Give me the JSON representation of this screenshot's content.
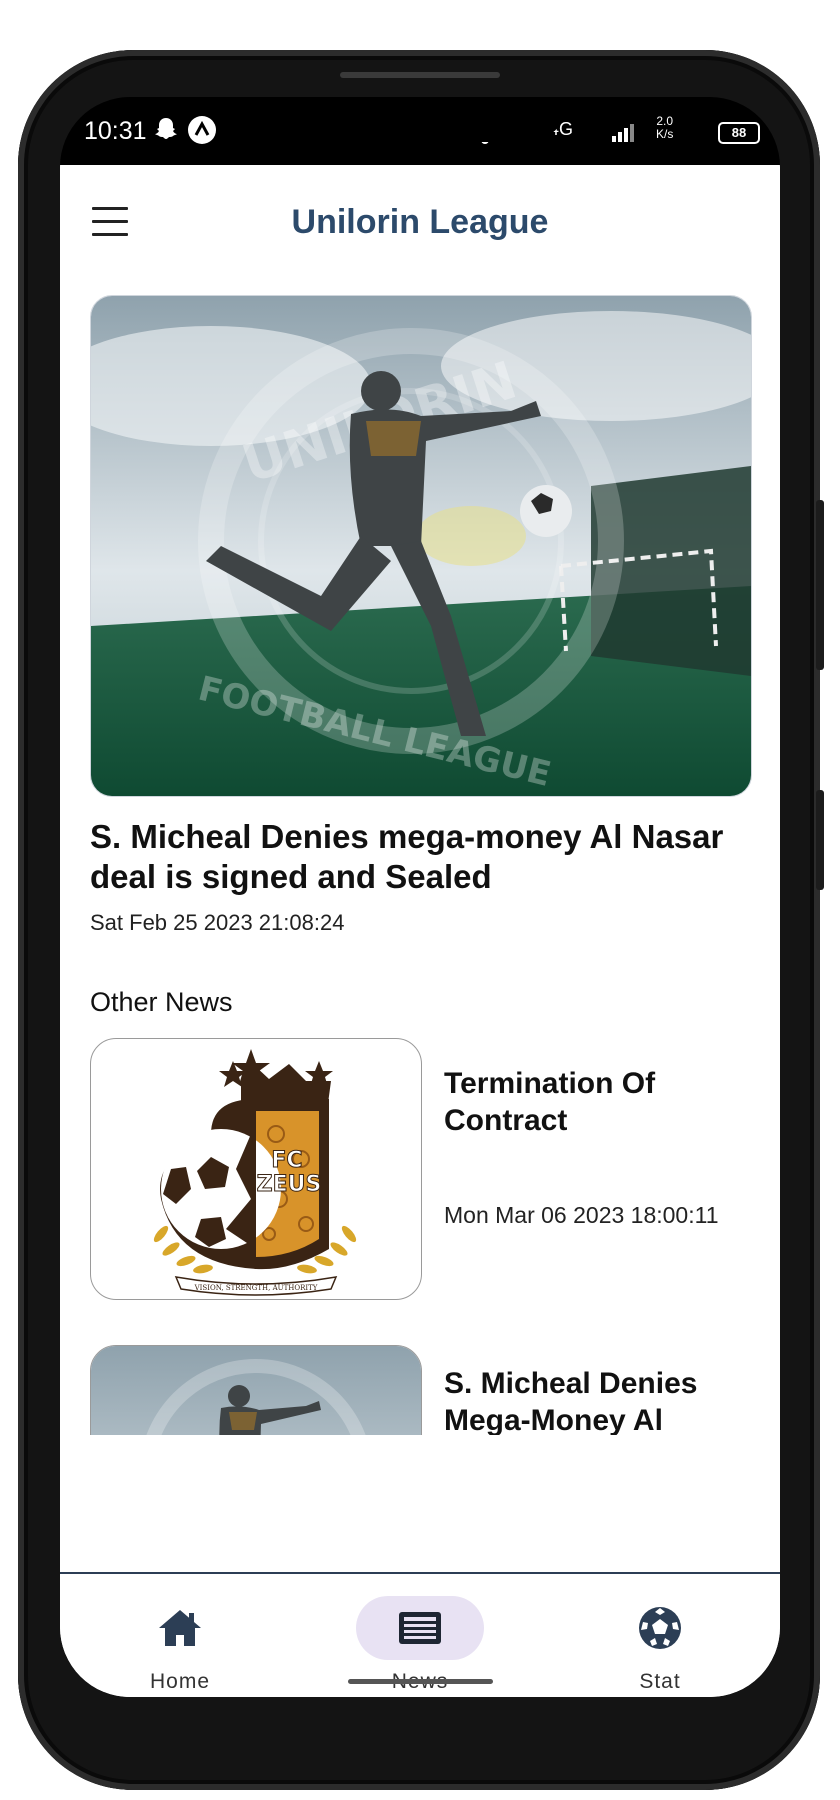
{
  "status_bar": {
    "time": "10:31",
    "network": "((o)) 4G",
    "speed_value": "2.0",
    "speed_unit": "K/s",
    "battery": "88"
  },
  "app_bar": {
    "title": "Unilorin League",
    "menu_icon": "hamburger-menu-icon"
  },
  "featured": {
    "title": "S. Micheal Denies mega-money Al Nasar deal is signed and Sealed",
    "date": "Sat Feb 25 2023 21:08:24",
    "watermark_top": "UNILORIN",
    "watermark_bottom": "FOOTBALL LEAGUE"
  },
  "other_news": {
    "label": "Other News",
    "items": [
      {
        "title": "Termination Of Contract",
        "date": "Mon Mar 06 2023 18:00:11",
        "logo_text_top": "FC",
        "logo_text_bottom": "ZEUS",
        "logo_ribbon": "VISION, STRENGTH, AUTHORITY"
      },
      {
        "title": "S. Micheal Denies Mega-Money Al Nasar Deal Is S..."
      }
    ]
  },
  "bottom_nav": {
    "items": [
      {
        "label": "Home",
        "icon": "home-icon"
      },
      {
        "label": "News",
        "icon": "newspaper-icon",
        "active": true
      },
      {
        "label": "Stat",
        "icon": "soccer-ball-icon"
      }
    ],
    "active_indicator_color": "#e8e2f3",
    "icon_color": "#2c3e55"
  },
  "colors": {
    "title": "#2c4a6b",
    "divider": "#2c3e55"
  }
}
